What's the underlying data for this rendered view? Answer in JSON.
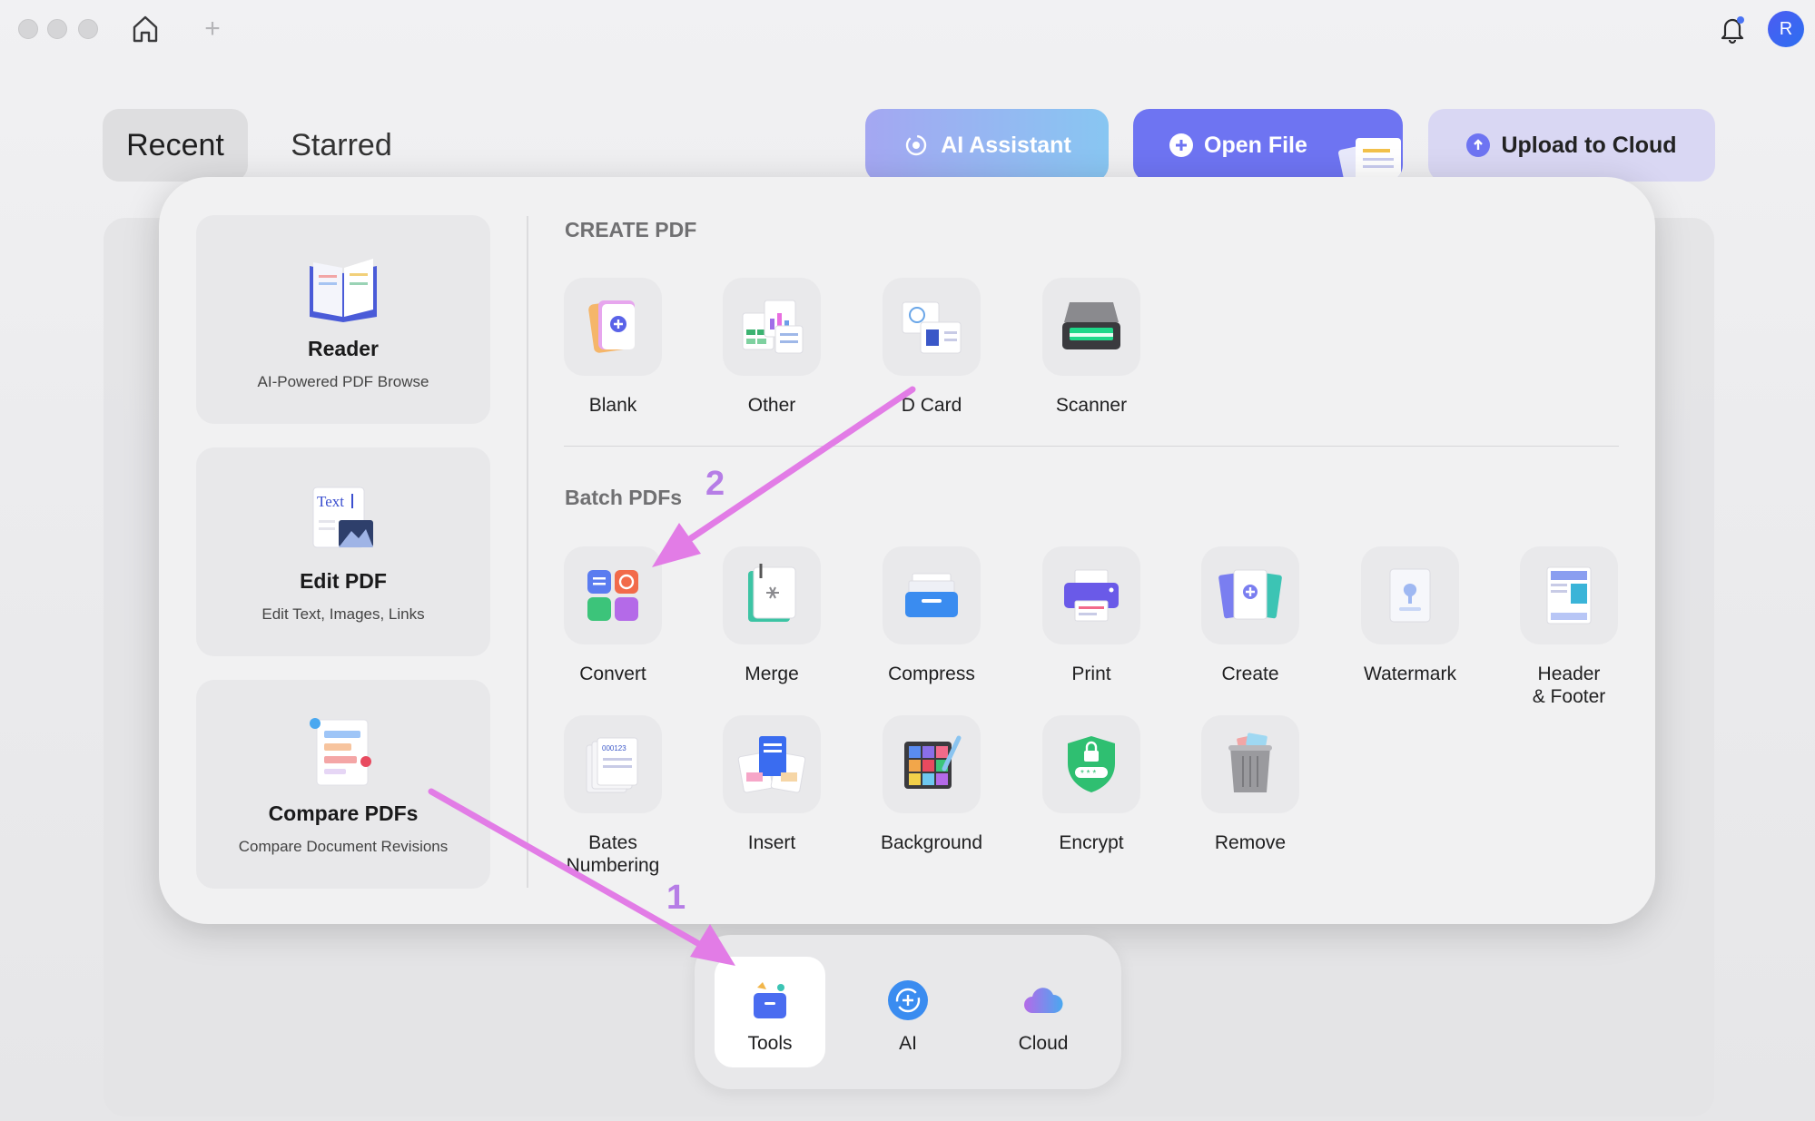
{
  "window": {
    "avatar_letter": "R"
  },
  "tabs": {
    "recent": "Recent",
    "starred": "Starred"
  },
  "header_buttons": {
    "ai_assistant": "AI Assistant",
    "open_file": "Open File",
    "upload": "Upload to Cloud"
  },
  "cards": [
    {
      "title": "Reader",
      "subtitle": "AI-Powered PDF Browse",
      "icon": "book-icon"
    },
    {
      "title": "Edit PDF",
      "subtitle": "Edit Text, Images, Links",
      "icon": "edit-text-icon",
      "icon_text": "Text"
    },
    {
      "title": "Compare PDFs",
      "subtitle": "Compare Document Revisions",
      "icon": "compare-icon"
    }
  ],
  "create_pdf": {
    "title": "CREATE PDF",
    "items": [
      "Blank",
      "Other",
      "D Card",
      "Scanner"
    ]
  },
  "batch_pdfs": {
    "title": "Batch PDFs",
    "row1": [
      "Convert",
      "Merge",
      "Compress",
      "Print",
      "Create",
      "Watermark",
      "Header\n& Footer"
    ],
    "row2": [
      "Bates\nNumbering",
      "Insert",
      "Background",
      "Encrypt",
      "Remove"
    ],
    "bates_label": "000123"
  },
  "dock": {
    "tools": "Tools",
    "ai": "AI",
    "cloud": "Cloud"
  },
  "annotations": {
    "step1": "1",
    "step2": "2"
  },
  "colors": {
    "accent": "#6e74f2",
    "arrow": "#e27ce6",
    "step_number": "#b67de6"
  }
}
